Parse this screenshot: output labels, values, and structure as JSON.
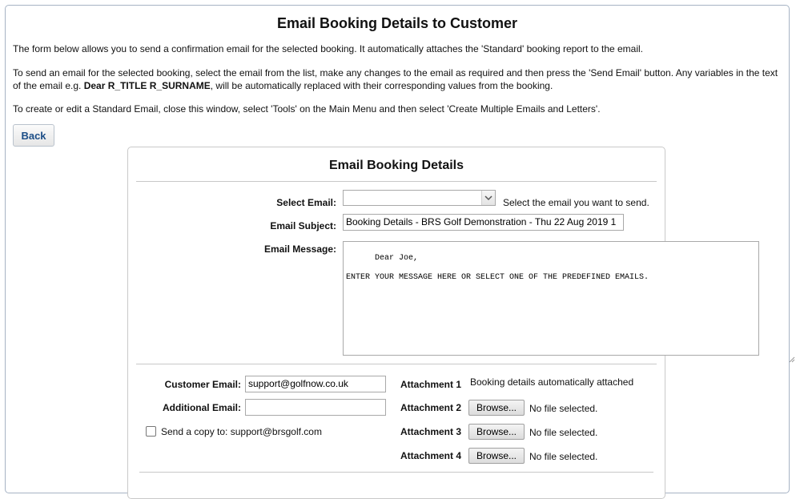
{
  "page": {
    "title": "Email Booking Details to Customer",
    "intro_1": "The form below allows you to send a confirmation email for the selected booking. It automatically attaches the 'Standard' booking report to the email.",
    "intro_2_before": "To send an email for the selected booking, select the email from the list, make any changes to the email as required and then press the 'Send Email' button. Any variables in the text of the email e.g. ",
    "intro_2_bold": "Dear R_TITLE R_SURNAME",
    "intro_2_after": ", will be automatically replaced with their corresponding values from the booking.",
    "intro_3": "To create or edit a Standard Email, close this window, select 'Tools' on the Main Menu and then select 'Create Multiple Emails and Letters'.",
    "back_label": "Back"
  },
  "form": {
    "title": "Email Booking Details",
    "select_email_label": "Select Email:",
    "select_email_value": "",
    "select_email_hint": "Select the email you want to send.",
    "subject_label": "Email Subject:",
    "subject_value": "Booking Details - BRS Golf Demonstration - Thu 22 Aug 2019 1",
    "message_label": "Email Message:",
    "message_value": "Dear Joe,\n\nENTER YOUR MESSAGE HERE OR SELECT ONE OF THE PREDEFINED EMAILS.",
    "customer_email_label": "Customer Email:",
    "customer_email_value": "support@golfnow.co.uk",
    "additional_email_label": "Additional Email:",
    "additional_email_value": "",
    "copy_label": "Send a copy to: support@brsgolf.com",
    "copy_checked": false
  },
  "attachments": [
    {
      "label": "Attachment 1",
      "status": "Booking details automatically attached"
    },
    {
      "label": "Attachment 2",
      "button": "Browse...",
      "status": "No file selected."
    },
    {
      "label": "Attachment 3",
      "button": "Browse...",
      "status": "No file selected."
    },
    {
      "label": "Attachment 4",
      "button": "Browse...",
      "status": "No file selected."
    }
  ],
  "icons": {
    "dropdown": "chevron-down-icon",
    "resize": "resize-grip-icon"
  },
  "colors": {
    "link_blue": "#1c4e87",
    "border": "#a6b3c4"
  }
}
